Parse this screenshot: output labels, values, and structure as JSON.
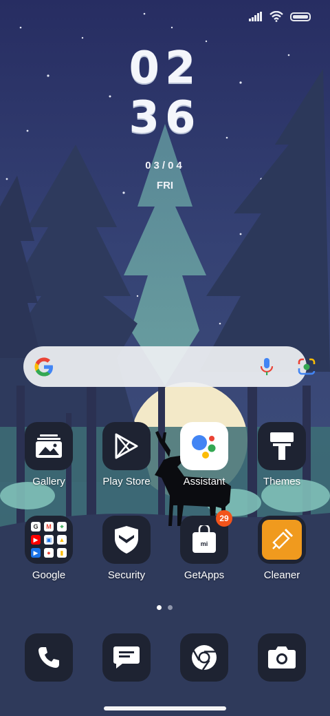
{
  "clock": {
    "hours": "02",
    "minutes": "36",
    "date": "03/04",
    "weekday": "FRI"
  },
  "status": {
    "signal_icon": "signal-icon",
    "wifi_icon": "wifi-icon",
    "battery_icon": "battery-icon"
  },
  "search": {
    "logo_icon": "google-g-icon",
    "mic_icon": "mic-icon",
    "lens_icon": "google-lens-icon"
  },
  "apps": [
    {
      "label": "Gallery",
      "icon": "gallery-icon"
    },
    {
      "label": "Play Store",
      "icon": "play-store-icon"
    },
    {
      "label": "Assistant",
      "icon": "assistant-icon"
    },
    {
      "label": "Themes",
      "icon": "paint-roller-icon"
    },
    {
      "label": "Google",
      "icon": "google-folder-icon"
    },
    {
      "label": "Security",
      "icon": "shield-icon"
    },
    {
      "label": "GetApps",
      "icon": "getapps-bag-icon",
      "badge": "29"
    },
    {
      "label": "Cleaner",
      "icon": "broom-icon"
    }
  ],
  "google_folder": {
    "tiles": [
      "G",
      "M",
      "⌖",
      "▶",
      "▣",
      "▲",
      "▶",
      "●",
      "▮"
    ]
  },
  "dock": [
    {
      "icon": "phone-icon"
    },
    {
      "icon": "messages-icon"
    },
    {
      "icon": "chrome-icon"
    },
    {
      "icon": "camera-icon"
    }
  ],
  "pager": {
    "pages": 2,
    "current": 1
  },
  "colors": {
    "sky_top": "#283064",
    "sky_mid": "#3a4a7c",
    "forest": "#2d3858",
    "accent_orange": "#f2541b",
    "cleaner_orange": "#f09a1e"
  }
}
